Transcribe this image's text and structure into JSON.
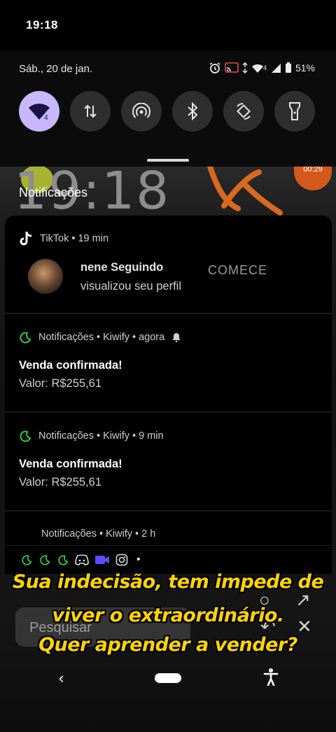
{
  "status_bar": {
    "time": "19:18"
  },
  "shade": {
    "date": "Sáb., 20 de jan.",
    "battery_percent": "51%",
    "network_badge": "4",
    "tiles": [
      {
        "name": "wifi-tile",
        "icon": "wifi-icon",
        "active": true
      },
      {
        "name": "mobile-data-tile",
        "icon": "data-arrows-icon",
        "active": false
      },
      {
        "name": "hotspot-tile",
        "icon": "hotspot-icon",
        "active": false
      },
      {
        "name": "bluetooth-tile",
        "icon": "bluetooth-icon",
        "active": false
      },
      {
        "name": "auto-rotate-tile",
        "icon": "rotate-icon",
        "active": false
      },
      {
        "name": "flashlight-tile",
        "icon": "flashlight-icon",
        "active": false
      }
    ],
    "accent_color": "#c7b8ff"
  },
  "background": {
    "clock": "19:18",
    "timer": "00:29"
  },
  "notifications": {
    "header": "Notificações",
    "tiktok": {
      "app_line": "TikTok • 19 min",
      "title": "nene Seguindo",
      "body": "visualizou seu perfil",
      "action": "COMECE"
    },
    "items": [
      {
        "app_line": "Notificações • Kiwify • agora",
        "title": "Venda confirmada!",
        "body": "Valor: R$255,61"
      },
      {
        "app_line": "Notificações • Kiwify • 9 min",
        "title": "Venda confirmada!",
        "body": "Valor: R$255,61"
      },
      {
        "app_line": "Notificações • Kiwify • 2 h"
      }
    ],
    "kiwify_color": "#2ecc40"
  },
  "caption": {
    "line1": "Sua indecisão, tem impede de",
    "line2": "viver o extraordinário.",
    "line3": "Quer aprender a vender?",
    "color": "#ffd400"
  },
  "background_ui": {
    "search_label": "Pesquisar"
  }
}
